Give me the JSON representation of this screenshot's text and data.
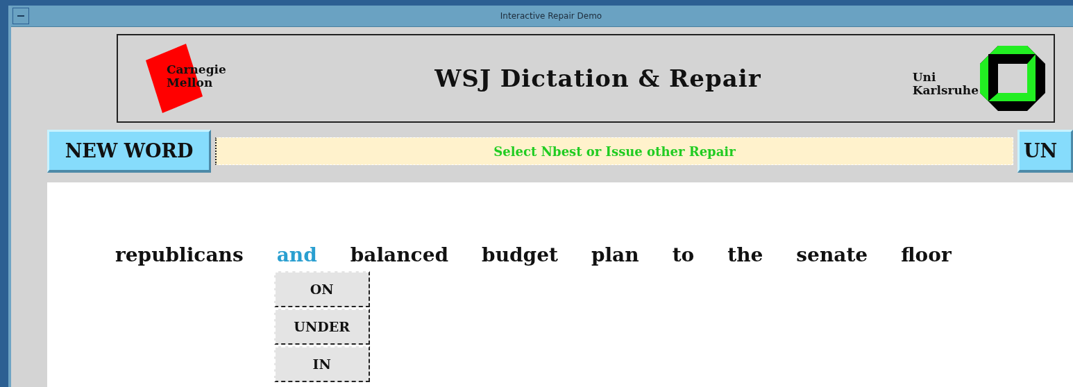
{
  "window": {
    "title": "Interactive Repair Demo"
  },
  "header": {
    "title": "WSJ Dictation & Repair",
    "left_logo": [
      "Carnegie",
      "Mellon"
    ],
    "right_logo": [
      "Uni",
      "Karlsruhe"
    ]
  },
  "toolbar": {
    "left_button": "NEW WORD",
    "status": "Select Nbest or Issue other Repair",
    "right_button": "UN"
  },
  "words": [
    {
      "text": "republicans",
      "selected": false
    },
    {
      "text": "and",
      "selected": true
    },
    {
      "text": "balanced",
      "selected": false
    },
    {
      "text": "budget",
      "selected": false
    },
    {
      "text": "plan",
      "selected": false
    },
    {
      "text": "to",
      "selected": false
    },
    {
      "text": "the",
      "selected": false
    },
    {
      "text": "senate",
      "selected": false
    },
    {
      "text": "floor",
      "selected": false
    }
  ],
  "nbest": [
    "ON",
    "UNDER",
    "IN"
  ]
}
